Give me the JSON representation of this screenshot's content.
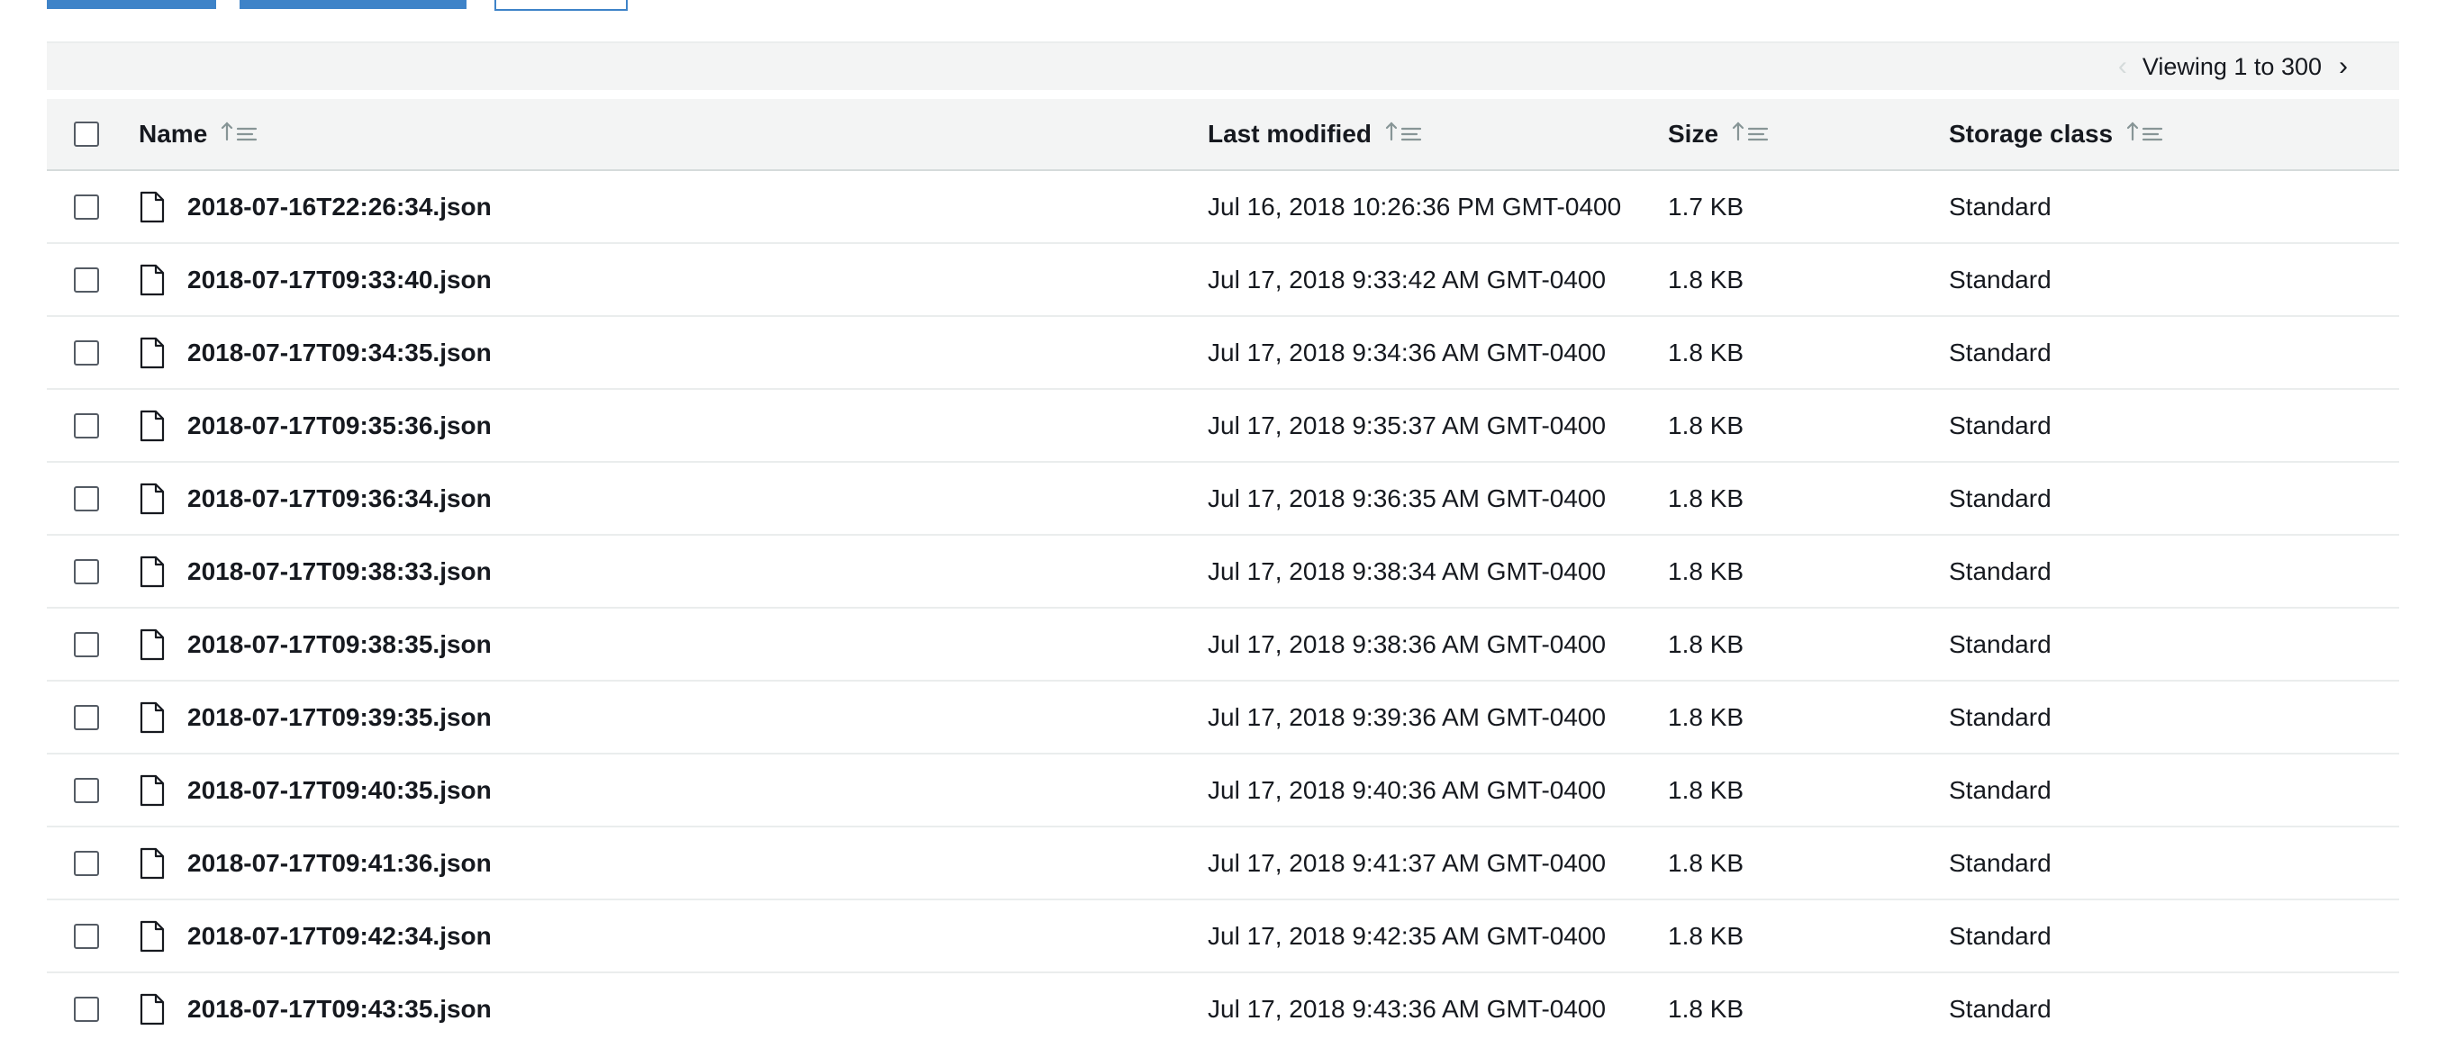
{
  "pagination": {
    "label": "Viewing 1 to 300"
  },
  "table": {
    "headers": {
      "name": "Name",
      "last_modified": "Last modified",
      "size": "Size",
      "storage_class": "Storage class"
    },
    "rows": [
      {
        "name": "2018-07-16T22:26:34.json",
        "last_modified": "Jul 16, 2018 10:26:36 PM GMT-0400",
        "size": "1.7 KB",
        "storage_class": "Standard"
      },
      {
        "name": "2018-07-17T09:33:40.json",
        "last_modified": "Jul 17, 2018 9:33:42 AM GMT-0400",
        "size": "1.8 KB",
        "storage_class": "Standard"
      },
      {
        "name": "2018-07-17T09:34:35.json",
        "last_modified": "Jul 17, 2018 9:34:36 AM GMT-0400",
        "size": "1.8 KB",
        "storage_class": "Standard"
      },
      {
        "name": "2018-07-17T09:35:36.json",
        "last_modified": "Jul 17, 2018 9:35:37 AM GMT-0400",
        "size": "1.8 KB",
        "storage_class": "Standard"
      },
      {
        "name": "2018-07-17T09:36:34.json",
        "last_modified": "Jul 17, 2018 9:36:35 AM GMT-0400",
        "size": "1.8 KB",
        "storage_class": "Standard"
      },
      {
        "name": "2018-07-17T09:38:33.json",
        "last_modified": "Jul 17, 2018 9:38:34 AM GMT-0400",
        "size": "1.8 KB",
        "storage_class": "Standard"
      },
      {
        "name": "2018-07-17T09:38:35.json",
        "last_modified": "Jul 17, 2018 9:38:36 AM GMT-0400",
        "size": "1.8 KB",
        "storage_class": "Standard"
      },
      {
        "name": "2018-07-17T09:39:35.json",
        "last_modified": "Jul 17, 2018 9:39:36 AM GMT-0400",
        "size": "1.8 KB",
        "storage_class": "Standard"
      },
      {
        "name": "2018-07-17T09:40:35.json",
        "last_modified": "Jul 17, 2018 9:40:36 AM GMT-0400",
        "size": "1.8 KB",
        "storage_class": "Standard"
      },
      {
        "name": "2018-07-17T09:41:36.json",
        "last_modified": "Jul 17, 2018 9:41:37 AM GMT-0400",
        "size": "1.8 KB",
        "storage_class": "Standard"
      },
      {
        "name": "2018-07-17T09:42:34.json",
        "last_modified": "Jul 17, 2018 9:42:35 AM GMT-0400",
        "size": "1.8 KB",
        "storage_class": "Standard"
      },
      {
        "name": "2018-07-17T09:43:35.json",
        "last_modified": "Jul 17, 2018 9:43:36 AM GMT-0400",
        "size": "1.8 KB",
        "storage_class": "Standard"
      }
    ]
  },
  "icons": {
    "file": "file-icon",
    "sort": "sort-ascending-icon",
    "prev": "chevron-left-icon",
    "next": "chevron-right-icon"
  },
  "colors": {
    "accent": "#3e83c8",
    "header_bg": "#f3f4f4",
    "text": "#16191f"
  }
}
